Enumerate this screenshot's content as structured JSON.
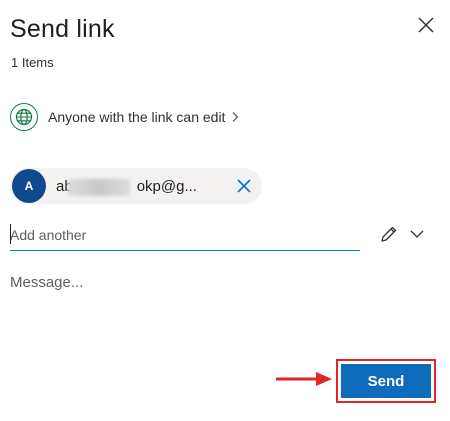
{
  "dialog": {
    "title": "Send link",
    "items_count": "1 Items",
    "permission": {
      "label": "Anyone with the link can edit",
      "icon": "globe-icon"
    },
    "recipients": [
      {
        "initial": "A",
        "email_prefix": "ab",
        "email_suffix": "okp@g...",
        "avatar_color": "#104a8e"
      }
    ],
    "add_input": {
      "placeholder": "Add another",
      "value": ""
    },
    "message": {
      "placeholder": "Message...",
      "value": ""
    },
    "send_label": "Send"
  },
  "colors": {
    "accent": "#0f6cbd",
    "globe": "#107c41",
    "annotation": "#e0252b"
  }
}
